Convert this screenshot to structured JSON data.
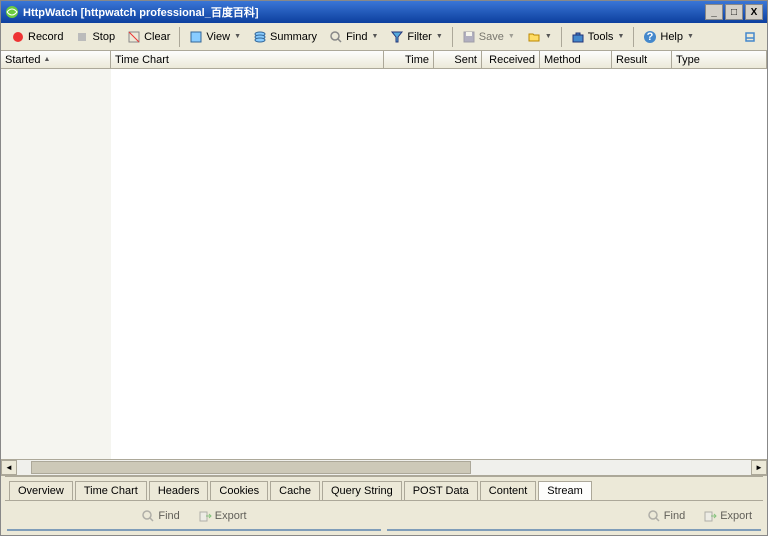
{
  "title": "HttpWatch [httpwatch professional_百度百科]",
  "toolbar": {
    "record": "Record",
    "stop": "Stop",
    "clear": "Clear",
    "view": "View",
    "summary": "Summary",
    "find": "Find",
    "filter": "Filter",
    "save": "Save",
    "tools": "Tools",
    "help": "Help"
  },
  "columns": [
    "Started",
    "Time Chart",
    "Time",
    "Sent",
    "Received",
    "Method",
    "Result",
    "Type"
  ],
  "tabs": [
    "Overview",
    "Time Chart",
    "Headers",
    "Cookies",
    "Cache",
    "Query String",
    "POST Data",
    "Content",
    "Stream"
  ],
  "activeTab": "Stream",
  "pane": {
    "find": "Find",
    "export": "Export"
  }
}
